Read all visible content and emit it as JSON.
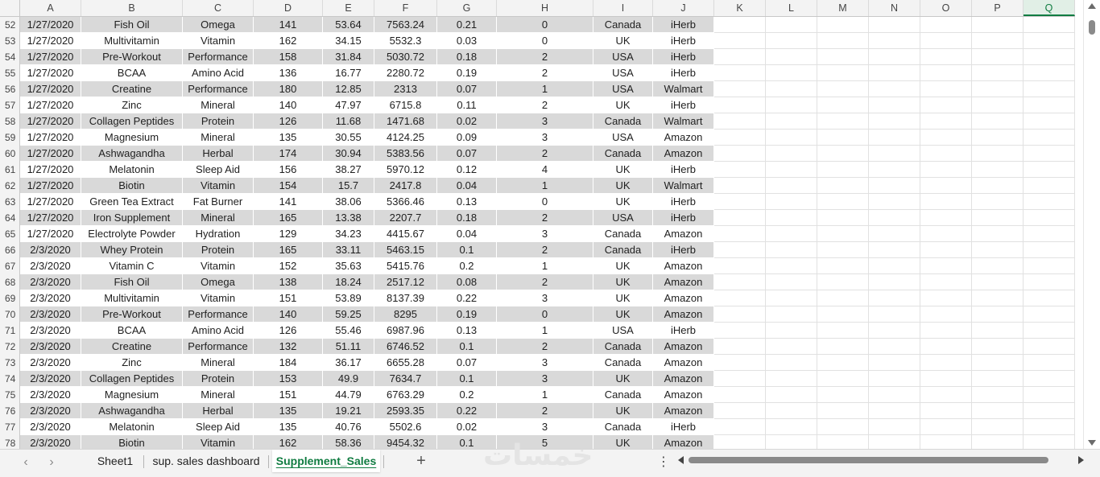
{
  "columns": [
    "A",
    "B",
    "C",
    "D",
    "E",
    "F",
    "G",
    "H",
    "I",
    "J",
    "K",
    "L",
    "M",
    "N",
    "O",
    "P",
    "Q"
  ],
  "selected_column": "Q",
  "rows": [
    {
      "n": "52",
      "cells": [
        "1/27/2020",
        "Fish Oil",
        "Omega",
        "141",
        "53.64",
        "7563.24",
        "0.21",
        "0",
        "Canada",
        "iHerb"
      ]
    },
    {
      "n": "53",
      "cells": [
        "1/27/2020",
        "Multivitamin",
        "Vitamin",
        "162",
        "34.15",
        "5532.3",
        "0.03",
        "0",
        "UK",
        "iHerb"
      ]
    },
    {
      "n": "54",
      "cells": [
        "1/27/2020",
        "Pre-Workout",
        "Performance",
        "158",
        "31.84",
        "5030.72",
        "0.18",
        "2",
        "USA",
        "iHerb"
      ]
    },
    {
      "n": "55",
      "cells": [
        "1/27/2020",
        "BCAA",
        "Amino Acid",
        "136",
        "16.77",
        "2280.72",
        "0.19",
        "2",
        "USA",
        "iHerb"
      ]
    },
    {
      "n": "56",
      "cells": [
        "1/27/2020",
        "Creatine",
        "Performance",
        "180",
        "12.85",
        "2313",
        "0.07",
        "1",
        "USA",
        "Walmart"
      ]
    },
    {
      "n": "57",
      "cells": [
        "1/27/2020",
        "Zinc",
        "Mineral",
        "140",
        "47.97",
        "6715.8",
        "0.11",
        "2",
        "UK",
        "iHerb"
      ]
    },
    {
      "n": "58",
      "cells": [
        "1/27/2020",
        "Collagen Peptides",
        "Protein",
        "126",
        "11.68",
        "1471.68",
        "0.02",
        "3",
        "Canada",
        "Walmart"
      ]
    },
    {
      "n": "59",
      "cells": [
        "1/27/2020",
        "Magnesium",
        "Mineral",
        "135",
        "30.55",
        "4124.25",
        "0.09",
        "3",
        "USA",
        "Amazon"
      ]
    },
    {
      "n": "60",
      "cells": [
        "1/27/2020",
        "Ashwagandha",
        "Herbal",
        "174",
        "30.94",
        "5383.56",
        "0.07",
        "2",
        "Canada",
        "Amazon"
      ]
    },
    {
      "n": "61",
      "cells": [
        "1/27/2020",
        "Melatonin",
        "Sleep Aid",
        "156",
        "38.27",
        "5970.12",
        "0.12",
        "4",
        "UK",
        "iHerb"
      ]
    },
    {
      "n": "62",
      "cells": [
        "1/27/2020",
        "Biotin",
        "Vitamin",
        "154",
        "15.7",
        "2417.8",
        "0.04",
        "1",
        "UK",
        "Walmart"
      ]
    },
    {
      "n": "63",
      "cells": [
        "1/27/2020",
        "Green Tea Extract",
        "Fat Burner",
        "141",
        "38.06",
        "5366.46",
        "0.13",
        "0",
        "UK",
        "iHerb"
      ]
    },
    {
      "n": "64",
      "cells": [
        "1/27/2020",
        "Iron Supplement",
        "Mineral",
        "165",
        "13.38",
        "2207.7",
        "0.18",
        "2",
        "USA",
        "iHerb"
      ]
    },
    {
      "n": "65",
      "cells": [
        "1/27/2020",
        "Electrolyte Powder",
        "Hydration",
        "129",
        "34.23",
        "4415.67",
        "0.04",
        "3",
        "Canada",
        "Amazon"
      ]
    },
    {
      "n": "66",
      "cells": [
        "2/3/2020",
        "Whey Protein",
        "Protein",
        "165",
        "33.11",
        "5463.15",
        "0.1",
        "2",
        "Canada",
        "iHerb"
      ]
    },
    {
      "n": "67",
      "cells": [
        "2/3/2020",
        "Vitamin C",
        "Vitamin",
        "152",
        "35.63",
        "5415.76",
        "0.2",
        "1",
        "UK",
        "Amazon"
      ]
    },
    {
      "n": "68",
      "cells": [
        "2/3/2020",
        "Fish Oil",
        "Omega",
        "138",
        "18.24",
        "2517.12",
        "0.08",
        "2",
        "UK",
        "Amazon"
      ]
    },
    {
      "n": "69",
      "cells": [
        "2/3/2020",
        "Multivitamin",
        "Vitamin",
        "151",
        "53.89",
        "8137.39",
        "0.22",
        "3",
        "UK",
        "Amazon"
      ]
    },
    {
      "n": "70",
      "cells": [
        "2/3/2020",
        "Pre-Workout",
        "Performance",
        "140",
        "59.25",
        "8295",
        "0.19",
        "0",
        "UK",
        "Amazon"
      ]
    },
    {
      "n": "71",
      "cells": [
        "2/3/2020",
        "BCAA",
        "Amino Acid",
        "126",
        "55.46",
        "6987.96",
        "0.13",
        "1",
        "USA",
        "iHerb"
      ]
    },
    {
      "n": "72",
      "cells": [
        "2/3/2020",
        "Creatine",
        "Performance",
        "132",
        "51.11",
        "6746.52",
        "0.1",
        "2",
        "Canada",
        "Amazon"
      ]
    },
    {
      "n": "73",
      "cells": [
        "2/3/2020",
        "Zinc",
        "Mineral",
        "184",
        "36.17",
        "6655.28",
        "0.07",
        "3",
        "Canada",
        "Amazon"
      ]
    },
    {
      "n": "74",
      "cells": [
        "2/3/2020",
        "Collagen Peptides",
        "Protein",
        "153",
        "49.9",
        "7634.7",
        "0.1",
        "3",
        "UK",
        "Amazon"
      ]
    },
    {
      "n": "75",
      "cells": [
        "2/3/2020",
        "Magnesium",
        "Mineral",
        "151",
        "44.79",
        "6763.29",
        "0.2",
        "1",
        "Canada",
        "Amazon"
      ]
    },
    {
      "n": "76",
      "cells": [
        "2/3/2020",
        "Ashwagandha",
        "Herbal",
        "135",
        "19.21",
        "2593.35",
        "0.22",
        "2",
        "UK",
        "Amazon"
      ]
    },
    {
      "n": "77",
      "cells": [
        "2/3/2020",
        "Melatonin",
        "Sleep Aid",
        "135",
        "40.76",
        "5502.6",
        "0.02",
        "3",
        "Canada",
        "iHerb"
      ]
    },
    {
      "n": "78",
      "cells": [
        "2/3/2020",
        "Biotin",
        "Vitamin",
        "162",
        "58.36",
        "9454.32",
        "0.1",
        "5",
        "UK",
        "Amazon"
      ]
    }
  ],
  "tabs": {
    "sheet1": "Sheet1",
    "dashboard": "sup. sales dashboard",
    "supplement_sales": "Supplement_Sales",
    "active": "Supplement_Sales"
  },
  "tabbar": {
    "prev_label": "‹",
    "next_label": "›",
    "add_label": "+",
    "more_label": "⋮",
    "watermark": "خمسات"
  },
  "colors": {
    "shade": "#d9d9d9",
    "accent": "#107c41"
  }
}
